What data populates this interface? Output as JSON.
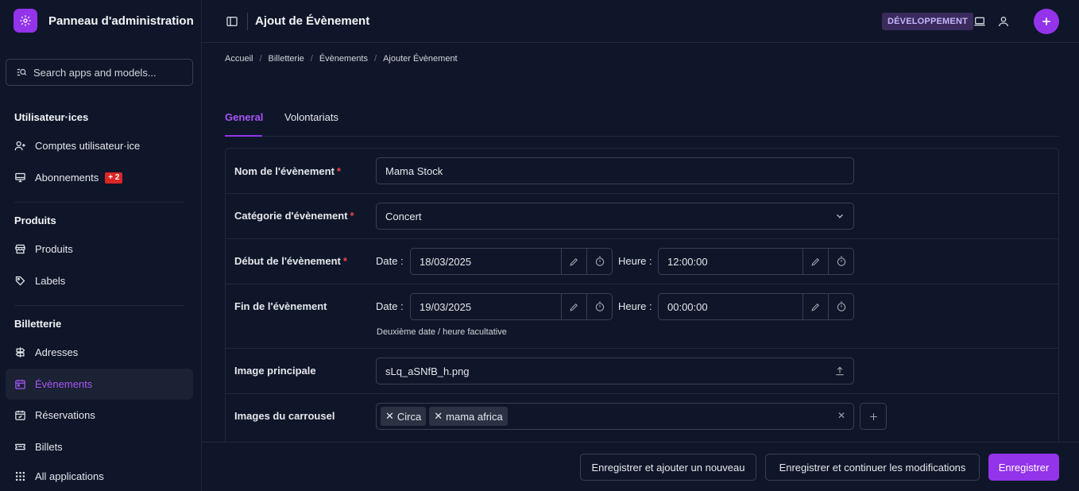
{
  "brand": {
    "title": "Panneau d'administration",
    "logo_icon": "gear-icon"
  },
  "search": {
    "placeholder": "Search apps and models..."
  },
  "sidebar": {
    "sections": [
      {
        "title": "Utilisateur·ices",
        "items": [
          {
            "label": "Comptes utilisateur·ice",
            "icon": "user-plus-icon"
          },
          {
            "label": "Abonnements",
            "icon": "monitor-icon",
            "badge": "+ 2"
          }
        ]
      },
      {
        "title": "Produits",
        "items": [
          {
            "label": "Produits",
            "icon": "store-icon"
          },
          {
            "label": "Labels",
            "icon": "tags-icon"
          }
        ]
      },
      {
        "title": "Billetterie",
        "items": [
          {
            "label": "Adresses",
            "icon": "signpost-icon"
          },
          {
            "label": "Évènements",
            "icon": "calendar-icon",
            "active": true
          },
          {
            "label": "Réservations",
            "icon": "calendar-check-icon"
          },
          {
            "label": "Billets",
            "icon": "ticket-icon"
          }
        ]
      }
    ],
    "all_apps": {
      "label": "All applications",
      "icon": "grid-icon"
    }
  },
  "header": {
    "title": "Ajout de Évènement",
    "env_badge": "DÉVELOPPEMENT"
  },
  "breadcrumb": [
    "Accueil",
    "Billetterie",
    "Évènements",
    "Ajouter Évènement"
  ],
  "tabs": [
    {
      "label": "General",
      "active": true
    },
    {
      "label": "Volontariats",
      "active": false
    }
  ],
  "form": {
    "name": {
      "label": "Nom de l'évènement",
      "value": "Mama Stock",
      "required": true
    },
    "category": {
      "label": "Catégorie d'évènement",
      "value": "Concert",
      "required": true
    },
    "start": {
      "label": "Début de l'évènement",
      "required": true,
      "date_label": "Date :",
      "date": "18/03/2025",
      "time_label": "Heure :",
      "time": "12:00:00"
    },
    "end": {
      "label": "Fin de l'évènement",
      "date_label": "Date :",
      "date": "19/03/2025",
      "time_label": "Heure :",
      "time": "00:00:00",
      "help": "Deuxième date / heure facultative"
    },
    "image": {
      "label": "Image principale",
      "value": "sLq_aSNfB_h.png"
    },
    "carousel": {
      "label": "Images du carrousel",
      "chips": [
        "Circa",
        "mama africa"
      ]
    }
  },
  "footer": {
    "save_add": "Enregistrer et ajouter un nouveau",
    "save_continue": "Enregistrer et continuer les modifications",
    "save": "Enregistrer"
  },
  "colors": {
    "accent": "#9333ea",
    "background": "#0f1629",
    "required": "#ef4444",
    "badge_red": "#dc2626"
  }
}
